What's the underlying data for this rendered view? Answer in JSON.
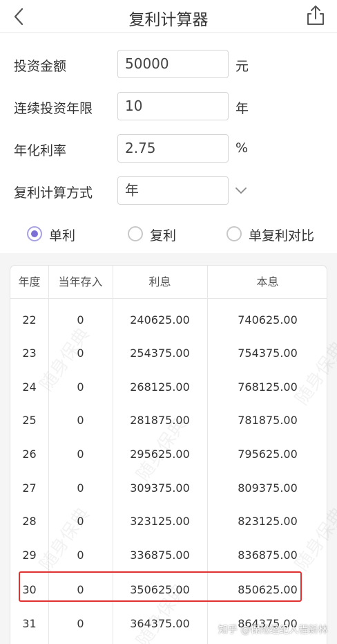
{
  "header": {
    "title": "复利计算器",
    "back_icon": "chevron-left-icon",
    "share_icon": "share-icon"
  },
  "form": {
    "principal": {
      "label": "投资金额",
      "value": "50000",
      "unit": "元"
    },
    "years": {
      "label": "连续投资年限",
      "value": "10",
      "unit": "年"
    },
    "rate": {
      "label": "年化利率",
      "value": "2.75",
      "unit": "%"
    },
    "method": {
      "label": "复利计算方式",
      "value": "年",
      "icon": "chevron-down-icon"
    }
  },
  "modes": [
    {
      "label": "单利",
      "checked": true
    },
    {
      "label": "复利",
      "checked": false
    },
    {
      "label": "单复利对比",
      "checked": false
    }
  ],
  "table": {
    "headers": [
      "年度",
      "当年存入",
      "利息",
      "本息"
    ],
    "rows": [
      [
        "22",
        "0",
        "240625.00",
        "740625.00"
      ],
      [
        "23",
        "0",
        "254375.00",
        "754375.00"
      ],
      [
        "24",
        "0",
        "268125.00",
        "768125.00"
      ],
      [
        "25",
        "0",
        "281875.00",
        "781875.00"
      ],
      [
        "26",
        "0",
        "295625.00",
        "795625.00"
      ],
      [
        "27",
        "0",
        "309375.00",
        "809375.00"
      ],
      [
        "28",
        "0",
        "323125.00",
        "823125.00"
      ],
      [
        "29",
        "0",
        "336875.00",
        "836875.00"
      ],
      [
        "30",
        "0",
        "350625.00",
        "850625.00"
      ],
      [
        "31",
        "0",
        "364375.00",
        "864375.00"
      ]
    ],
    "highlighted_year": "30"
  },
  "watermark": "随身保典",
  "credit": "知乎 @保险经纪人程新林",
  "colors": {
    "accent": "#7b6fd6",
    "highlight_border": "#e03030"
  }
}
